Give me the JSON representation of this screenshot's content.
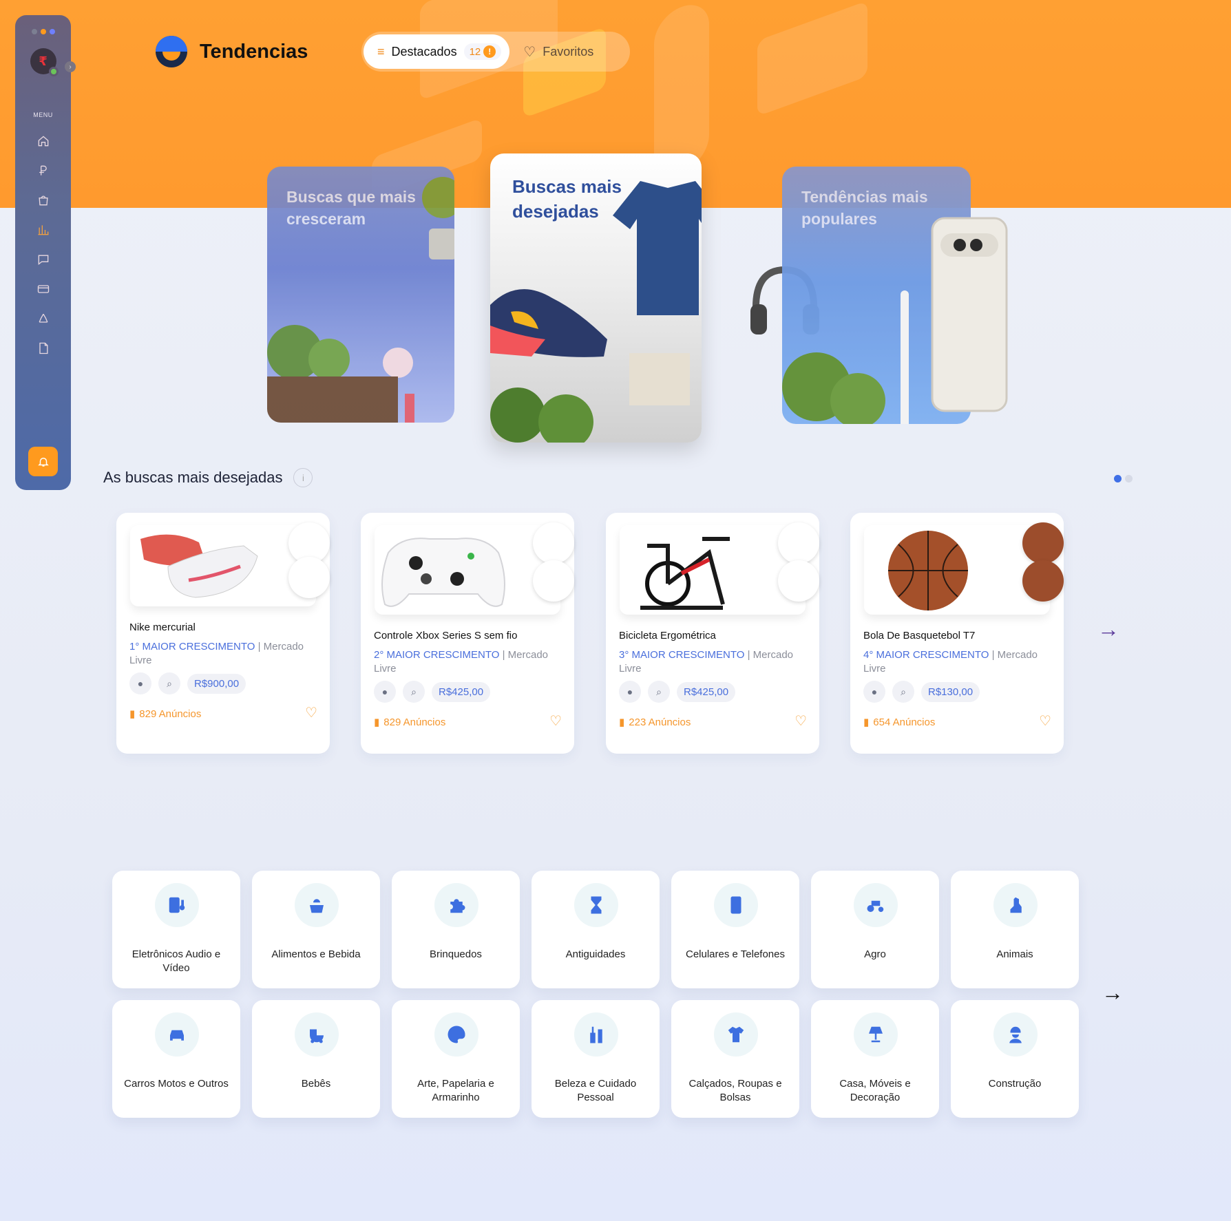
{
  "window": {
    "dot_colors": [
      "#7c7f92",
      "#ff9a1e",
      "#6f80ff"
    ]
  },
  "header": {
    "title": "Tendencias",
    "tabs": [
      {
        "label": "Destacados",
        "count": "12",
        "active": true
      },
      {
        "label": "Favoritos",
        "active": false
      }
    ]
  },
  "sidebar": {
    "menu_label": "MENU",
    "items": [
      "home-icon",
      "currency-icon",
      "shopping-bag-icon",
      "bar-chart-icon",
      "chat-icon",
      "credit-card-icon",
      "recycle-icon",
      "document-icon"
    ],
    "bell": "bell-icon"
  },
  "showcase": [
    {
      "title": "Buscas que mais cresceram"
    },
    {
      "title": "Buscas mais desejadas"
    },
    {
      "title": "Tendências mais populares"
    }
  ],
  "section": {
    "title": "As buscas mais desejadas",
    "info": "i"
  },
  "products": [
    {
      "name": "Nike mercurial",
      "rank": "1° MAIOR CRESCIMENTO",
      "source": " | Mercado Livre",
      "price": "R$900,00",
      "ads": "829 Anúncios"
    },
    {
      "name": "Controle Xbox Series S sem fio",
      "rank": "2° MAIOR CRESCIMENTO",
      "source": " | Mercado Livre",
      "price": "R$425,00",
      "ads": "829 Anúncios"
    },
    {
      "name": "Bicicleta Ergométrica",
      "rank": "3° MAIOR CRESCIMENTO",
      "source": " | Mercado Livre",
      "price": "R$425,00",
      "ads": "223 Anúncios"
    },
    {
      "name": "Bola De Basquetebol T7",
      "rank": "4° MAIOR CRESCIMENTO",
      "source": " | Mercado Livre",
      "price": "R$130,00",
      "ads": "654 Anúncios"
    }
  ],
  "categories": [
    {
      "label": "Eletrônicos Audio e Vídeo",
      "icon": "electronics-icon"
    },
    {
      "label": "Alimentos e Bebida",
      "icon": "food-icon"
    },
    {
      "label": "Brinquedos",
      "icon": "puzzle-icon"
    },
    {
      "label": "Antiguidades",
      "icon": "hourglass-icon"
    },
    {
      "label": "Celulares e Telefones",
      "icon": "phone-icon"
    },
    {
      "label": "Agro",
      "icon": "tractor-icon"
    },
    {
      "label": "Animais",
      "icon": "dog-icon"
    },
    {
      "label": "Carros Motos e Outros",
      "icon": "car-icon"
    },
    {
      "label": "Bebês",
      "icon": "stroller-icon"
    },
    {
      "label": "Arte, Papelaria e Armarinho",
      "icon": "palette-icon"
    },
    {
      "label": "Beleza e Cuidado Pessoal",
      "icon": "cosmetics-icon"
    },
    {
      "label": "Calçados, Roupas e Bolsas",
      "icon": "shirt-icon"
    },
    {
      "label": "Casa, Móveis e Decoração",
      "icon": "lamp-icon"
    },
    {
      "label": "Construção",
      "icon": "worker-icon"
    }
  ],
  "colors": {
    "accent": "#ff9a1e",
    "primary": "#3d6fe0"
  }
}
